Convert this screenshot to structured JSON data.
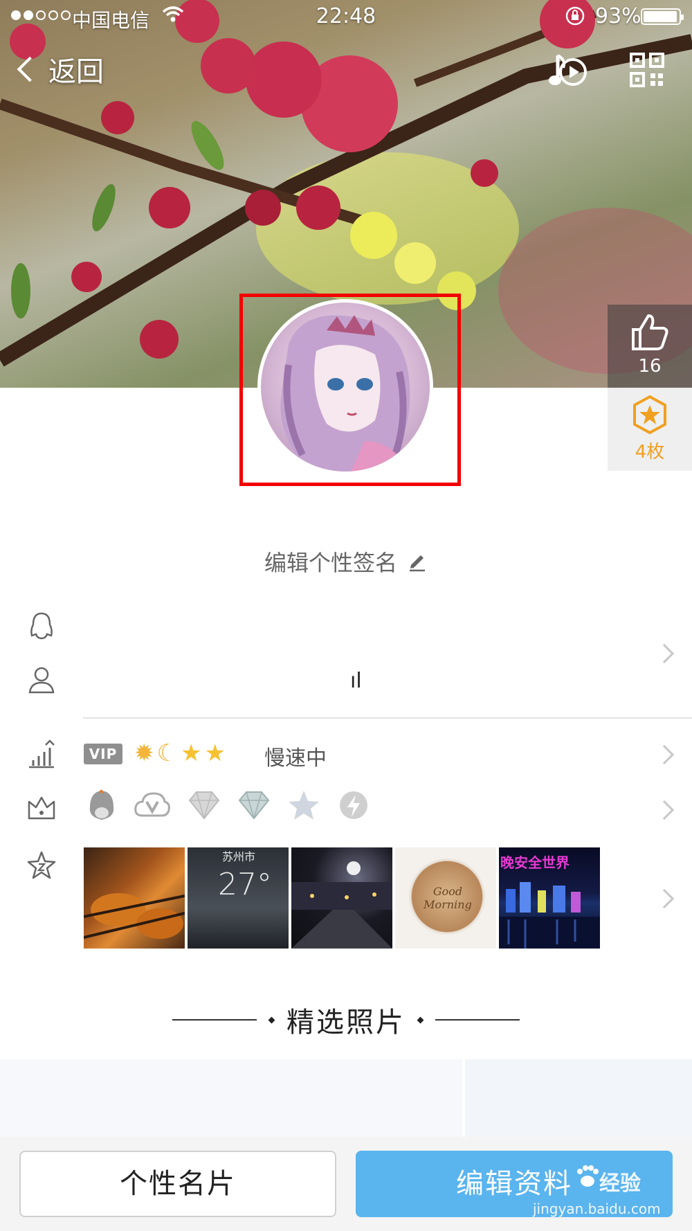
{
  "status_bar": {
    "carrier": "中国电信",
    "time": "22:48",
    "battery": "93%"
  },
  "nav": {
    "back_label": "返回"
  },
  "stats": {
    "likes": "16",
    "coins": "4枚"
  },
  "profile": {
    "signature_prompt": "编辑个性签名",
    "nickname_fragment": "ıl"
  },
  "level": {
    "vip_badge": "VIP",
    "speed_status": "慢速中"
  },
  "photos": {
    "weather_city": "苏州市",
    "weather_temp": "27°",
    "coffee_text": "Good Morning",
    "night_caption": "晚安全世界"
  },
  "featured": {
    "title": "精选照片"
  },
  "actions": {
    "card_button": "个性名片",
    "edit_button": "编辑资料"
  },
  "watermark": {
    "brand": "经验",
    "url": "jingyan.baidu.com"
  },
  "colors": {
    "accent_blue": "#5ab4ee",
    "highlight_red": "#f20000",
    "coin_orange": "#f0a020"
  }
}
